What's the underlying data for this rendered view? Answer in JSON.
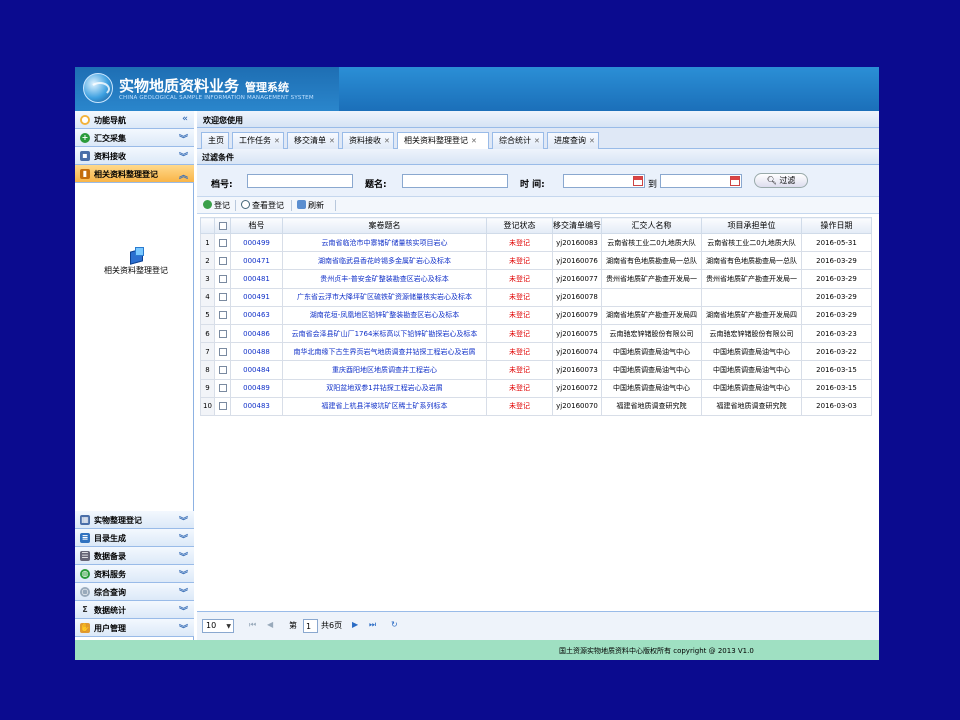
{
  "header": {
    "title": "实物地质资料业务",
    "title_suffix": "管理系统",
    "subtitle": "CHINA GEOLOGICAL SAMPLE INFORMATION MANAGEMENT SYSTEM"
  },
  "sidebar": {
    "title": "功能导航",
    "collapse_icon": "«",
    "items_top": [
      {
        "label": "汇交采集",
        "icon": "plus-circle-icon",
        "color": "#2a9b3a"
      },
      {
        "label": "资料接收",
        "icon": "contact-icon",
        "color": "#4a6ea8"
      },
      {
        "label": "相关资料整理登记",
        "icon": "book-icon",
        "color": "#d47a10"
      }
    ],
    "sub_item": "相关资料整理登记",
    "items_bottom": [
      {
        "label": "实物整理登记",
        "icon": "grid-icon",
        "color": "#4a6ea8"
      },
      {
        "label": "目录生成",
        "icon": "list-icon",
        "color": "#2f72c0"
      },
      {
        "label": "数据备录",
        "icon": "numbered-list-icon",
        "color": "#556"
      },
      {
        "label": "资料服务",
        "icon": "globe-icon",
        "color": "#2a9b3a"
      },
      {
        "label": "综合查询",
        "icon": "search-icon",
        "color": "#8aa"
      },
      {
        "label": "数据统计",
        "icon": "sigma-icon",
        "color": "#555"
      },
      {
        "label": "用户管理",
        "icon": "hand-icon",
        "color": "#d98a20"
      }
    ]
  },
  "main": {
    "welcome": "欢迎您使用",
    "tabs": [
      "主页",
      "工作任务",
      "移交清单",
      "资料接收",
      "相关资料整理登记",
      "综合统计",
      "进度查询"
    ],
    "active_tab": 4,
    "filter_title": "过滤条件",
    "filter": {
      "archive_label": "档号:",
      "title_label": "题名:",
      "time_label": "时 间:",
      "to_label": "到",
      "search_label": "过滤"
    },
    "toolbar": {
      "register": "登记",
      "view": "查看登记",
      "refresh": "刷新"
    },
    "table": {
      "headers": [
        "档号",
        "案卷题名",
        "登记状态",
        "移交清单编号",
        "汇交人名称",
        "项目承担单位",
        "操作日期"
      ],
      "rows": [
        {
          "n": "1",
          "id": "000499",
          "title": "云南省临沧市中寨锗矿储量核实项目岩心",
          "status": "未登记",
          "list": "yj20160083",
          "submitter": "云南省核工业二0九地质大队",
          "unit": "云南省核工业二0九地质大队",
          "date": "2016-05-31"
        },
        {
          "n": "2",
          "id": "000471",
          "title": "湖南省临武县香花岭锡多金属矿岩心及标本",
          "status": "未登记",
          "list": "yj20160076",
          "submitter": "湖南省有色地质勘查局一总队",
          "unit": "湖南省有色地质勘查局一总队",
          "date": "2016-03-29"
        },
        {
          "n": "3",
          "id": "000481",
          "title": "贵州贞丰-普安金矿整装勘查区岩心及标本",
          "status": "未登记",
          "list": "yj20160077",
          "submitter": "贵州省地质矿产勘查开发局一",
          "unit": "贵州省地质矿产勘查开发局一",
          "date": "2016-03-29"
        },
        {
          "n": "4",
          "id": "000491",
          "title": "广东省云浮市大降坪矿区硫铁矿资源储量核实岩心及标本",
          "status": "未登记",
          "list": "yj20160078",
          "submitter": "",
          "unit": "",
          "date": "2016-03-29"
        },
        {
          "n": "5",
          "id": "000463",
          "title": "湖南花垣-凤凰地区铅锌矿整装勘查区岩心及标本",
          "status": "未登记",
          "list": "yj20160079",
          "submitter": "湖南省地质矿产勘查开发局四",
          "unit": "湖南省地质矿产勘查开发局四",
          "date": "2016-03-29"
        },
        {
          "n": "6",
          "id": "000486",
          "title": "云南省会泽县矿山厂1764米标高以下铅锌矿勘探岩心及标本",
          "status": "未登记",
          "list": "yj20160075",
          "submitter": "云南驰宏锌锗股份有限公司",
          "unit": "云南驰宏锌锗股份有限公司",
          "date": "2016-03-23"
        },
        {
          "n": "7",
          "id": "000488",
          "title": "南华北南缘下古生界页岩气地质调查井钻探工程岩心及岩屑",
          "status": "未登记",
          "list": "yj20160074",
          "submitter": "中国地质调查局油气中心",
          "unit": "中国地质调查局油气中心",
          "date": "2016-03-22"
        },
        {
          "n": "8",
          "id": "000484",
          "title": "重庆酉阳地区地质调查井工程岩心",
          "status": "未登记",
          "list": "yj20160073",
          "submitter": "中国地质调查局油气中心",
          "unit": "中国地质调查局油气中心",
          "date": "2016-03-15"
        },
        {
          "n": "9",
          "id": "000489",
          "title": "双阳盆地双参1井钻探工程岩心及岩屑",
          "status": "未登记",
          "list": "yj20160072",
          "submitter": "中国地质调查局油气中心",
          "unit": "中国地质调查局油气中心",
          "date": "2016-03-15"
        },
        {
          "n": "10",
          "id": "000483",
          "title": "福建省上杭县洋坡坑矿区稀土矿系列标本",
          "status": "未登记",
          "list": "yj20160070",
          "submitter": "福建省地质调查研究院",
          "unit": "福建省地质调查研究院",
          "date": "2016-03-03"
        }
      ]
    },
    "pager": {
      "page_size": "10",
      "page_label": "第",
      "page_value": "1",
      "total_label": "共6页"
    }
  },
  "footer": {
    "text": "国土资源实物地质资料中心版权所有  copyright @ 2013 V1.0"
  }
}
